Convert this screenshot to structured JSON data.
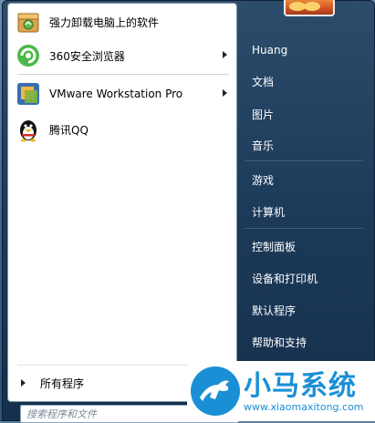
{
  "programs": [
    {
      "label": "强力卸载电脑上的软件",
      "icon": "uninstall-box-icon",
      "has_submenu": false
    },
    {
      "label": "360安全浏览器",
      "icon": "360-browser-icon",
      "has_submenu": true
    },
    {
      "label": "VMware Workstation Pro",
      "icon": "vmware-icon",
      "has_submenu": true
    },
    {
      "label": "腾讯QQ",
      "icon": "qq-penguin-icon",
      "has_submenu": false
    }
  ],
  "all_programs_label": "所有程序",
  "search": {
    "placeholder": "搜索程序和文件"
  },
  "right_links": [
    {
      "label": "Huang"
    },
    {
      "label": "文档"
    },
    {
      "label": "图片"
    },
    {
      "label": "音乐"
    },
    {
      "label": "游戏"
    },
    {
      "label": "计算机"
    },
    {
      "label": "控制面板"
    },
    {
      "label": "设备和打印机"
    },
    {
      "label": "默认程序"
    },
    {
      "label": "帮助和支持"
    }
  ],
  "watermark": {
    "title": "小马系统",
    "url": "www.xiaomaxitong.com"
  },
  "colors": {
    "accent": "#1a8fd6",
    "menu_dark": "#1c3a59",
    "pane_white": "#ffffff"
  }
}
